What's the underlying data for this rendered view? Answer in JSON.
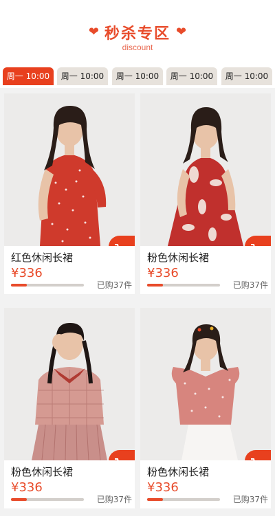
{
  "header": {
    "title": "秒杀专区",
    "subtitle": "discount",
    "heart_left": "❤",
    "heart_right": "❤"
  },
  "tabs": [
    {
      "label": "周一 10:00",
      "active": true
    },
    {
      "label": "周一 10:00",
      "active": false
    },
    {
      "label": "周一 10:00",
      "active": false
    },
    {
      "label": "周一 10:00",
      "active": false
    },
    {
      "label": "周一 10:00",
      "active": false
    }
  ],
  "products": [
    {
      "name": "红色休闲长裙",
      "price": "¥336",
      "sold": "已购37件",
      "progress": 0.22
    },
    {
      "name": "粉色休闲长裙",
      "price": "¥336",
      "sold": "已购37件",
      "progress": 0.22
    },
    {
      "name": "粉色休闲长裙",
      "price": "¥336",
      "sold": "已购37件",
      "progress": 0.22
    },
    {
      "name": "粉色休闲长裙",
      "price": "¥336",
      "sold": "已购37件",
      "progress": 0.22
    }
  ],
  "icons": {
    "cart": "shopping-cart-icon",
    "heart": "heart-icon"
  },
  "colors": {
    "accent": "#e84b2a",
    "tab_active": "#e8401e",
    "tab_inactive": "#e7e2dc",
    "background": "#f2f2f2"
  }
}
